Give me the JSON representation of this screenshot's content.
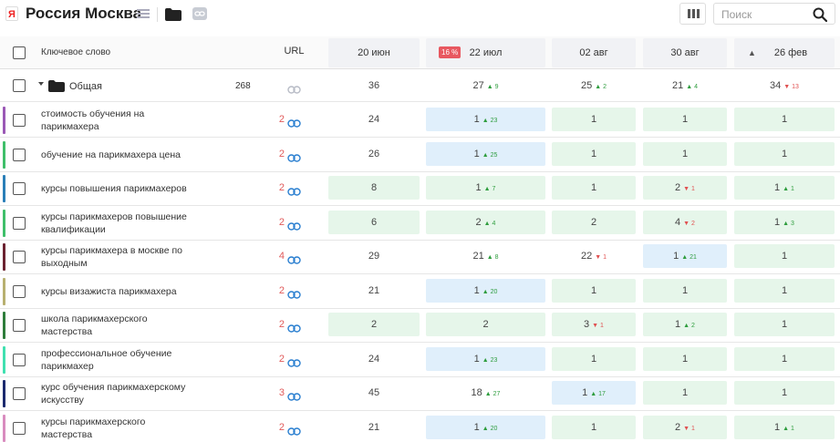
{
  "header": {
    "logo_letter": "Я",
    "title": "Россия Москва",
    "search_placeholder": "Поиск"
  },
  "table": {
    "col_keyword": "Ключевое слово",
    "col_url": "URL",
    "dates": [
      "20 июн",
      "22 июл",
      "02 авг",
      "30 авг",
      "26 фев"
    ],
    "pct_badge": "16 %",
    "sort_arrow": "▲"
  },
  "group": {
    "label": "Общая",
    "count": "268",
    "positions": [
      {
        "v": "36",
        "d": "",
        "dir": ""
      },
      {
        "v": "27",
        "d": "9",
        "dir": "up"
      },
      {
        "v": "25",
        "d": "2",
        "dir": "up"
      },
      {
        "v": "21",
        "d": "4",
        "dir": "up"
      },
      {
        "v": "34",
        "d": "13",
        "dir": "down"
      }
    ]
  },
  "colors": {
    "green_cell": "#e6f6ea",
    "blue_cell": "#e0effb",
    "up": "#2e9d3e",
    "down": "#e05050"
  },
  "rows": [
    {
      "kw": "стоимость обучения на парикмахера",
      "url": "2",
      "bar": "#9b59b6",
      "cells": [
        {
          "v": "24",
          "d": "",
          "dir": "",
          "bg": ""
        },
        {
          "v": "1",
          "d": "23",
          "dir": "up",
          "bg": "blue"
        },
        {
          "v": "1",
          "d": "",
          "dir": "",
          "bg": "green"
        },
        {
          "v": "1",
          "d": "",
          "dir": "",
          "bg": "green"
        },
        {
          "v": "1",
          "d": "",
          "dir": "",
          "bg": "green"
        }
      ]
    },
    {
      "kw": "обучение на парикмахера цена",
      "url": "2",
      "bar": "#3fbf6a",
      "cells": [
        {
          "v": "26",
          "d": "",
          "dir": "",
          "bg": ""
        },
        {
          "v": "1",
          "d": "25",
          "dir": "up",
          "bg": "blue"
        },
        {
          "v": "1",
          "d": "",
          "dir": "",
          "bg": "green"
        },
        {
          "v": "1",
          "d": "",
          "dir": "",
          "bg": "green"
        },
        {
          "v": "1",
          "d": "",
          "dir": "",
          "bg": "green"
        }
      ]
    },
    {
      "kw": "курсы повышения парикмахеров",
      "url": "2",
      "bar": "#2a7fb8",
      "cells": [
        {
          "v": "8",
          "d": "",
          "dir": "",
          "bg": "green"
        },
        {
          "v": "1",
          "d": "7",
          "dir": "up",
          "bg": "green"
        },
        {
          "v": "1",
          "d": "",
          "dir": "",
          "bg": "green"
        },
        {
          "v": "2",
          "d": "1",
          "dir": "down",
          "bg": "green"
        },
        {
          "v": "1",
          "d": "1",
          "dir": "up",
          "bg": "green"
        }
      ]
    },
    {
      "kw": "курсы парикмахеров повышение квалификации",
      "url": "2",
      "bar": "#3fbf6a",
      "cells": [
        {
          "v": "6",
          "d": "",
          "dir": "",
          "bg": "green"
        },
        {
          "v": "2",
          "d": "4",
          "dir": "up",
          "bg": "green"
        },
        {
          "v": "2",
          "d": "",
          "dir": "",
          "bg": "green"
        },
        {
          "v": "4",
          "d": "2",
          "dir": "down",
          "bg": "green"
        },
        {
          "v": "1",
          "d": "3",
          "dir": "up",
          "bg": "green"
        }
      ]
    },
    {
      "kw": "курсы парикмахера в москве по выходным",
      "url": "4",
      "bar": "#6b2230",
      "cells": [
        {
          "v": "29",
          "d": "",
          "dir": "",
          "bg": ""
        },
        {
          "v": "21",
          "d": "8",
          "dir": "up",
          "bg": ""
        },
        {
          "v": "22",
          "d": "1",
          "dir": "down",
          "bg": ""
        },
        {
          "v": "1",
          "d": "21",
          "dir": "up",
          "bg": "blue"
        },
        {
          "v": "1",
          "d": "",
          "dir": "",
          "bg": "green"
        }
      ]
    },
    {
      "kw": "курсы визажиста парикмахера",
      "url": "2",
      "bar": "#b8b070",
      "cells": [
        {
          "v": "21",
          "d": "",
          "dir": "",
          "bg": ""
        },
        {
          "v": "1",
          "d": "20",
          "dir": "up",
          "bg": "blue"
        },
        {
          "v": "1",
          "d": "",
          "dir": "",
          "bg": "green"
        },
        {
          "v": "1",
          "d": "",
          "dir": "",
          "bg": "green"
        },
        {
          "v": "1",
          "d": "",
          "dir": "",
          "bg": "green"
        }
      ]
    },
    {
      "kw": "школа парикмахерского мастерства",
      "url": "2",
      "bar": "#2e7d3a",
      "cells": [
        {
          "v": "2",
          "d": "",
          "dir": "",
          "bg": "green"
        },
        {
          "v": "2",
          "d": "",
          "dir": "",
          "bg": "green"
        },
        {
          "v": "3",
          "d": "1",
          "dir": "down",
          "bg": "green"
        },
        {
          "v": "1",
          "d": "2",
          "dir": "up",
          "bg": "green"
        },
        {
          "v": "1",
          "d": "",
          "dir": "",
          "bg": "green"
        }
      ]
    },
    {
      "kw": "профессиональное обучение парикмахер",
      "url": "2",
      "bar": "#40e0b0",
      "cells": [
        {
          "v": "24",
          "d": "",
          "dir": "",
          "bg": ""
        },
        {
          "v": "1",
          "d": "23",
          "dir": "up",
          "bg": "blue"
        },
        {
          "v": "1",
          "d": "",
          "dir": "",
          "bg": "green"
        },
        {
          "v": "1",
          "d": "",
          "dir": "",
          "bg": "green"
        },
        {
          "v": "1",
          "d": "",
          "dir": "",
          "bg": "green"
        }
      ]
    },
    {
      "kw": "курс обучения парикмахерскому искусству",
      "url": "3",
      "bar": "#1c2a6e",
      "cells": [
        {
          "v": "45",
          "d": "",
          "dir": "",
          "bg": ""
        },
        {
          "v": "18",
          "d": "27",
          "dir": "up",
          "bg": ""
        },
        {
          "v": "1",
          "d": "17",
          "dir": "up",
          "bg": "blue"
        },
        {
          "v": "1",
          "d": "",
          "dir": "",
          "bg": "green"
        },
        {
          "v": "1",
          "d": "",
          "dir": "",
          "bg": "green"
        }
      ]
    },
    {
      "kw": "курсы парикмахерского мастерства",
      "url": "2",
      "bar": "#d98cbf",
      "cells": [
        {
          "v": "21",
          "d": "",
          "dir": "",
          "bg": ""
        },
        {
          "v": "1",
          "d": "20",
          "dir": "up",
          "bg": "blue"
        },
        {
          "v": "1",
          "d": "",
          "dir": "",
          "bg": "green"
        },
        {
          "v": "2",
          "d": "1",
          "dir": "down",
          "bg": "green"
        },
        {
          "v": "1",
          "d": "1",
          "dir": "up",
          "bg": "green"
        }
      ]
    }
  ]
}
